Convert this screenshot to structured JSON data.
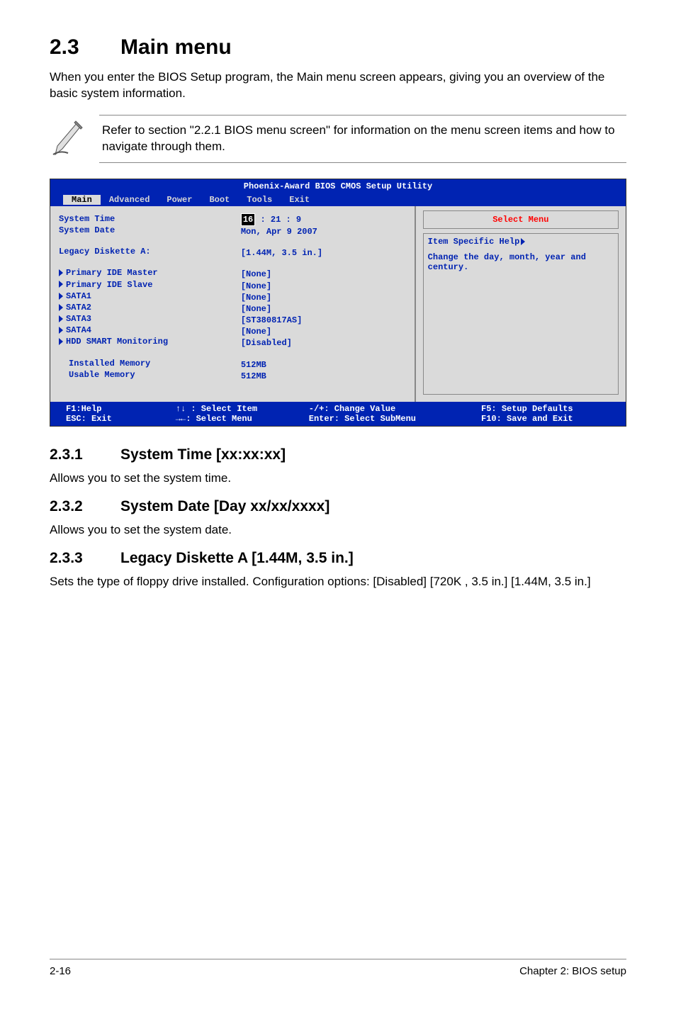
{
  "heading": {
    "num": "2.3",
    "title": "Main menu"
  },
  "intro": "When you enter the BIOS Setup program, the Main menu screen appears, giving you an overview of the basic system information.",
  "note": "Refer to section \"2.2.1  BIOS menu screen\" for information on the menu screen items and how to navigate through them.",
  "bios": {
    "title": "Phoenix-Award BIOS CMOS Setup Utility",
    "tabs": {
      "main": "Main",
      "advanced": "Advanced",
      "power": "Power",
      "boot": "Boot",
      "tools": "Tools",
      "exit": "Exit"
    },
    "left": {
      "system_time": "System Time",
      "system_date": "System Date",
      "legacy_diskette": "Legacy Diskette A:",
      "pim": "Primary IDE Master",
      "pis": "Primary IDE Slave",
      "sata1": "SATA1",
      "sata2": "SATA2",
      "sata3": "SATA3",
      "sata4": "SATA4",
      "hdd": "HDD SMART Monitoring",
      "installed": "Installed Memory",
      "usable": "Usable Memory"
    },
    "center": {
      "time_hour": "16",
      "time_rest": " : 21 : 9",
      "date": "Mon, Apr  9 2007",
      "legacy": "[1.44M, 3.5 in.]",
      "pim": "[None]",
      "pis": "[None]",
      "sata1": "[None]",
      "sata2": "[None]",
      "sata3": "[ST380817AS]",
      "sata4": "[None]",
      "hdd": "[Disabled]",
      "installed": "512MB",
      "usable": "512MB"
    },
    "right": {
      "select_menu": "Select Menu",
      "help_title": "Item Specific Help",
      "help_text": "Change the day, month, year and century."
    },
    "footer": {
      "f1": "F1:Help",
      "esc": "ESC: Exit",
      "updown": "↑↓ : Select Item",
      "leftright": "→←: Select Menu",
      "change": "-/+: Change Value",
      "enter": "Enter: Select SubMenu",
      "f5": "F5: Setup Defaults",
      "f10": "F10: Save and Exit"
    }
  },
  "s231": {
    "num": "2.3.1",
    "title": "System Time [xx:xx:xx]",
    "text": "Allows you to set the system time."
  },
  "s232": {
    "num": "2.3.2",
    "title": "System Date [Day xx/xx/xxxx]",
    "text": "Allows you to set the system date."
  },
  "s233": {
    "num": "2.3.3",
    "title": "Legacy Diskette A [1.44M, 3.5 in.]",
    "text": "Sets the type of floppy drive installed. Configuration options: [Disabled] [720K , 3.5 in.] [1.44M, 3.5 in.]"
  },
  "footer": {
    "left": "2-16",
    "right": "Chapter 2: BIOS setup"
  }
}
